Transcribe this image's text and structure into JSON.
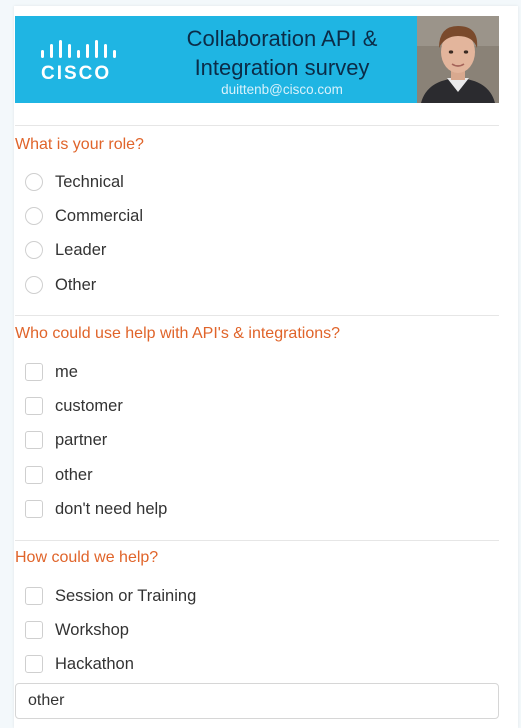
{
  "header": {
    "brand": "CISCO",
    "title_line1": "Collaboration API &",
    "title_line2": "Integration survey",
    "email": "duittenb@cisco.com",
    "accent_color": "#1fb5e3"
  },
  "role_section": {
    "title": "What is your role?",
    "options": [
      {
        "label": "Technical",
        "selected": false
      },
      {
        "label": "Commercial",
        "selected": false
      },
      {
        "label": "Leader",
        "selected": false
      },
      {
        "label": "Other",
        "selected": false
      }
    ]
  },
  "help_who_section": {
    "title": "Who could use help with API's & integrations?",
    "options": [
      {
        "label": "me",
        "checked": false
      },
      {
        "label": "customer",
        "checked": false
      },
      {
        "label": "partner",
        "checked": false
      },
      {
        "label": "other",
        "checked": false
      },
      {
        "label": "don't need help",
        "checked": false
      }
    ]
  },
  "help_how_section": {
    "title": "How could we help?",
    "options": [
      {
        "label": "Session or Training",
        "checked": false
      },
      {
        "label": "Workshop",
        "checked": false
      },
      {
        "label": "Hackathon",
        "checked": false
      }
    ],
    "other_value": "other"
  }
}
